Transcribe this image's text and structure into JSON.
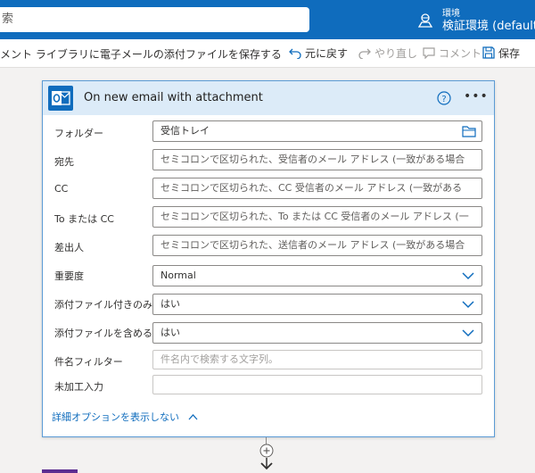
{
  "header": {
    "search_text": "索",
    "environment_label": "環境",
    "environment_name": "検証環境 (default)"
  },
  "command_bar": {
    "flow_title": "メント ライブラリに電子メールの添付ファイルを保存する",
    "undo_label": "元に戻す",
    "redo_label": "やり直し",
    "comment_label": "コメント",
    "save_label": "保存"
  },
  "trigger_card": {
    "title": "On new email with attachment",
    "fields": [
      {
        "label": "フォルダー",
        "value": "受信トレイ",
        "placeholder": ""
      },
      {
        "label": "宛先",
        "value": "",
        "placeholder": "セミコロンで区切られた、受信者のメール アドレス (一致がある場合"
      },
      {
        "label": "CC",
        "value": "",
        "placeholder": "セミコロンで区切られた、CC 受信者のメール アドレス (一致がある"
      },
      {
        "label": "To または CC",
        "value": "",
        "placeholder": "セミコロンで区切られた、To または CC 受信者のメール アドレス (一"
      },
      {
        "label": "差出人",
        "value": "",
        "placeholder": "セミコロンで区切られた、送信者のメール アドレス (一致がある場合"
      },
      {
        "label": "重要度",
        "value": "Normal",
        "placeholder": ""
      },
      {
        "label": "添付ファイル付きのみ",
        "value": "はい",
        "placeholder": ""
      },
      {
        "label": "添付ファイルを含める",
        "value": "はい",
        "placeholder": ""
      },
      {
        "label": "件名フィルター",
        "value": "",
        "placeholder": "件名内で検索する文字列。"
      },
      {
        "label": "未加工入力",
        "value": "",
        "placeholder": ""
      }
    ],
    "advanced_link": "詳細オプションを表示しない"
  },
  "colors": {
    "header_bg": "#0f6cbd",
    "card_header_bg": "#dcebf8",
    "link": "#0f6cbd"
  }
}
